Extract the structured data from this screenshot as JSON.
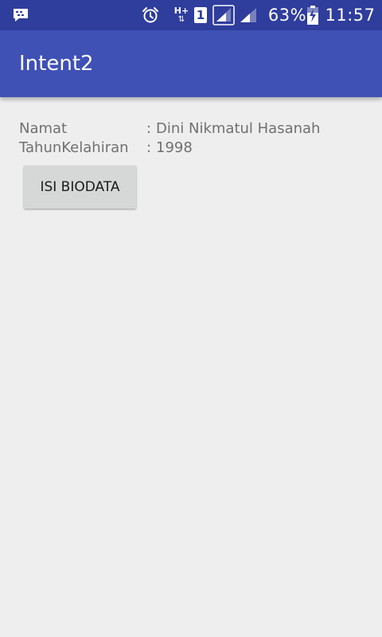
{
  "status_bar": {
    "notification_icon": "bbm-notification-icon",
    "alarm_icon": "alarm-clock-icon",
    "network_type": "H+",
    "sim_slot": "1",
    "battery_percent": "63%",
    "time": "11:57"
  },
  "app_bar": {
    "title": "Intent2",
    "color": "#3f51b5",
    "status_color": "#2f3d9c"
  },
  "biodata": [
    {
      "label": "Namat",
      "separator": ":",
      "value": "Dini Nikmatul Hasanah"
    },
    {
      "label": "TahunKelahiran",
      "separator": ":",
      "value": "1998"
    }
  ],
  "actions": {
    "isi_biodata_label": "ISI BIODATA"
  }
}
